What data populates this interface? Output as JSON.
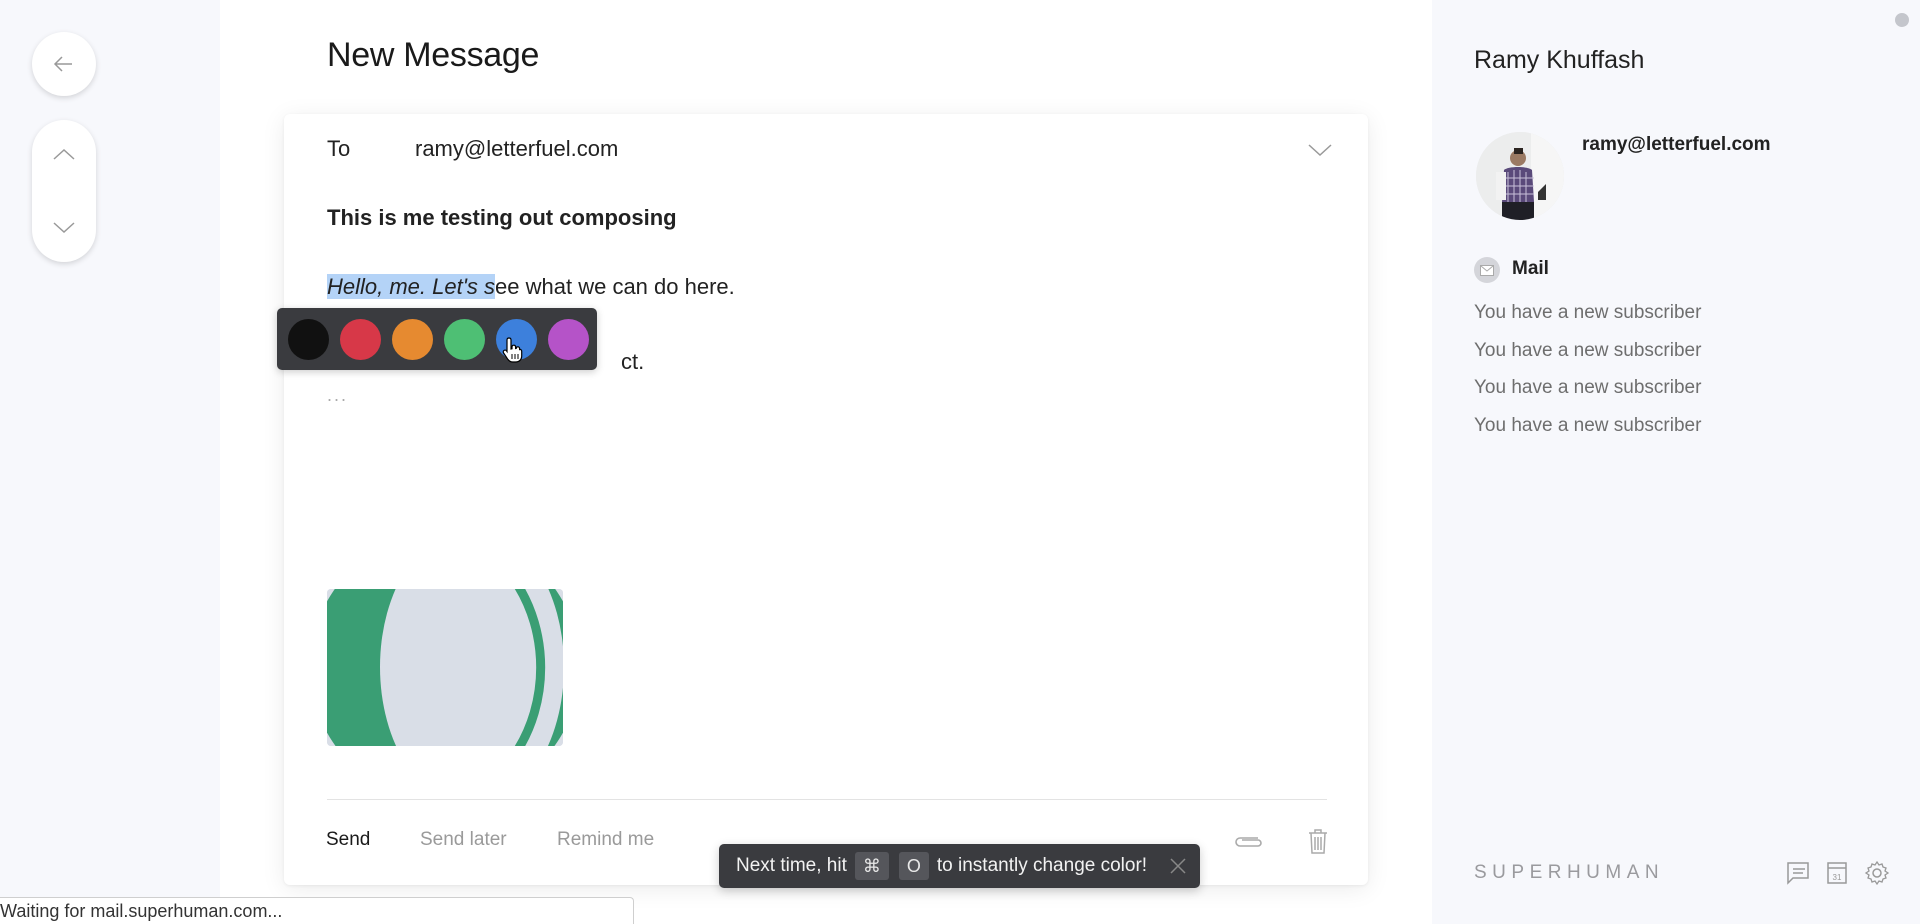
{
  "nav": {
    "back_icon": "arrow-left-icon",
    "up_icon": "chevron-up-icon",
    "down_icon": "chevron-down-icon"
  },
  "compose": {
    "title": "New Message",
    "to_label": "To",
    "to_value": "ramy@letterfuel.com",
    "subject": "This is me testing out composing",
    "body_selected": "Hello, me. Let's s",
    "body_rest": "ee what we can do here.",
    "body_line2_visible": "ct.",
    "ellipsis": "...",
    "palette": {
      "colors": [
        "#111111",
        "#d73848",
        "#e68a30",
        "#4ebf74",
        "#3d80dc",
        "#b553c8"
      ],
      "names": [
        "black",
        "red",
        "orange",
        "green",
        "blue",
        "purple"
      ],
      "hovered": "blue"
    },
    "footer": {
      "send": "Send",
      "send_later": "Send later",
      "remind_me": "Remind me"
    }
  },
  "toast": {
    "prefix": "Next time, hit",
    "key1": "⌘",
    "key2": "O",
    "suffix": "to instantly change color!"
  },
  "contact": {
    "name": "Ramy Khuffash",
    "email": "ramy@letterfuel.com",
    "mail_section_label": "Mail",
    "mail_items": [
      "You have a new subscriber",
      "You have a new subscriber",
      "You have a new subscriber",
      "You have a new subscriber"
    ]
  },
  "brand": "SUPERHUMAN",
  "statusbar": "Waiting for mail.superhuman.com..."
}
